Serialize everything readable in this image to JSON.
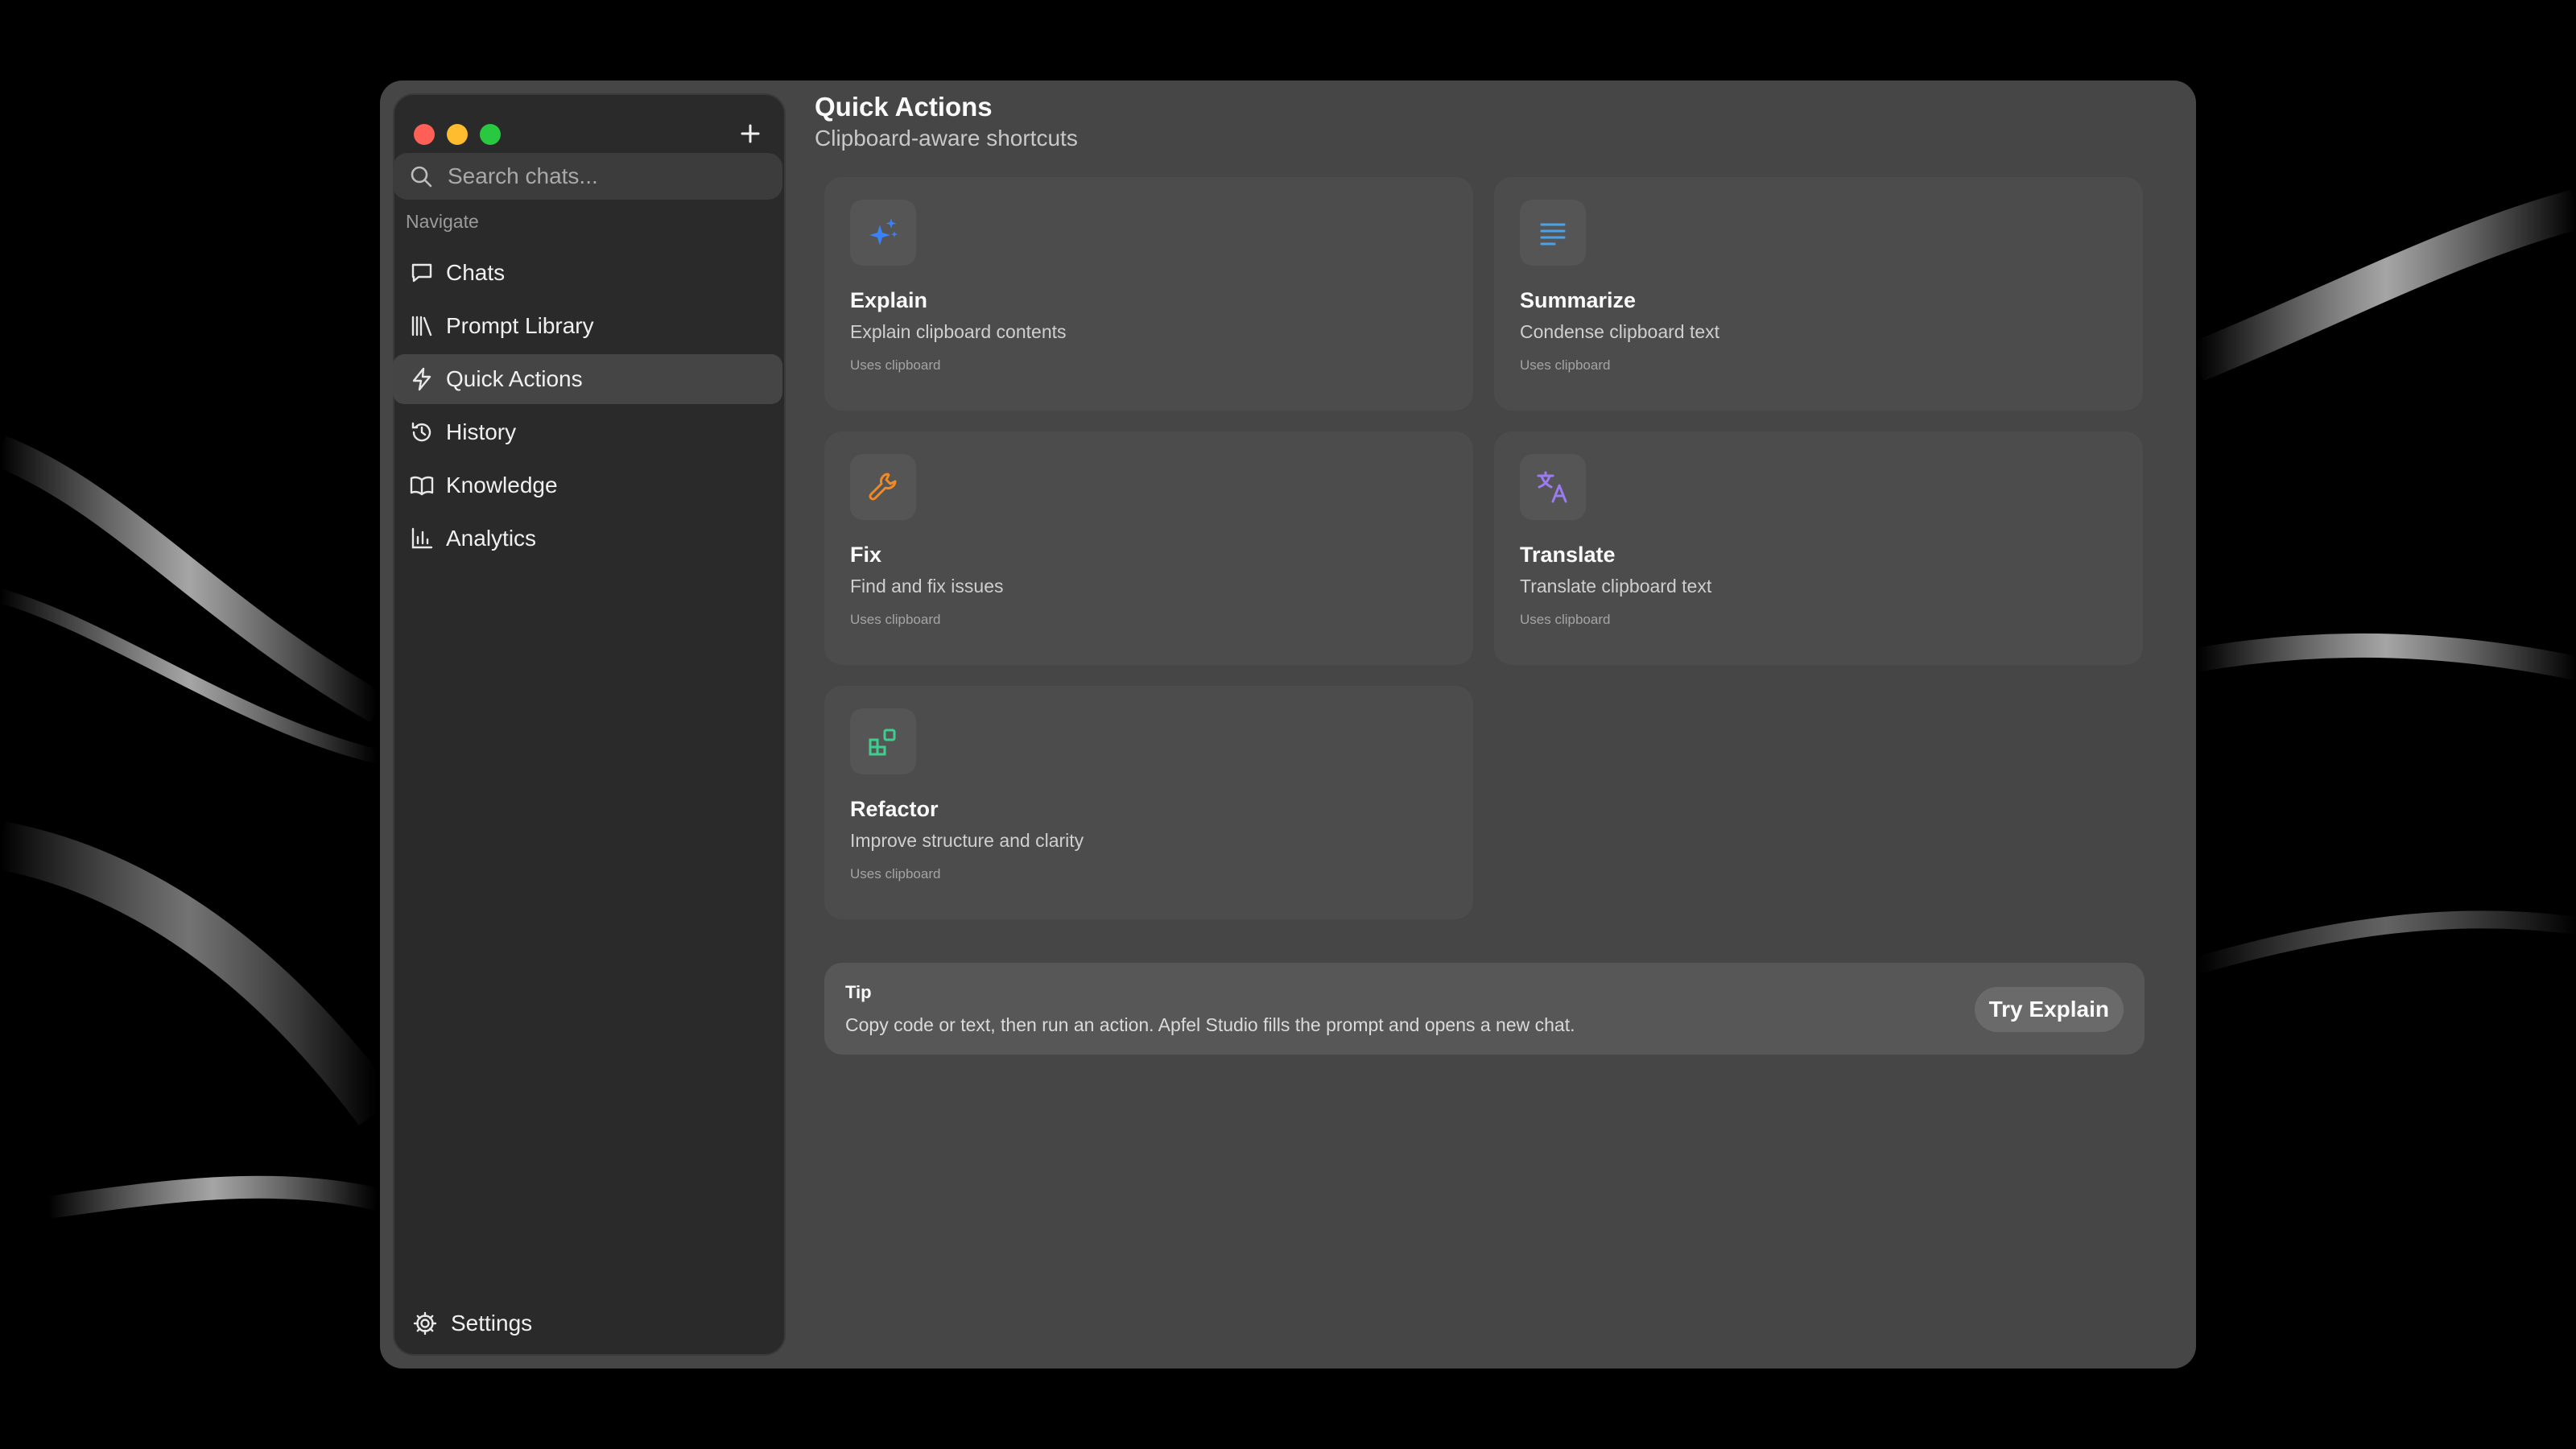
{
  "sidebar": {
    "search_placeholder": "Search chats...",
    "section_label": "Navigate",
    "items": [
      {
        "label": "Chats",
        "icon": "chat-bubble-icon"
      },
      {
        "label": "Prompt Library",
        "icon": "library-icon"
      },
      {
        "label": "Quick Actions",
        "icon": "lightning-icon",
        "active": true
      },
      {
        "label": "History",
        "icon": "history-icon"
      },
      {
        "label": "Knowledge",
        "icon": "book-icon"
      },
      {
        "label": "Analytics",
        "icon": "bar-chart-icon"
      }
    ],
    "settings_label": "Settings"
  },
  "main": {
    "title": "Quick Actions",
    "subtitle": "Clipboard-aware shortcuts",
    "cards": [
      {
        "title": "Explain",
        "description": "Explain clipboard contents",
        "footer": "Uses clipboard",
        "icon": "sparkles-icon",
        "accent": "#3b82f6"
      },
      {
        "title": "Summarize",
        "description": "Condense clipboard text",
        "footer": "Uses clipboard",
        "icon": "text-lines-icon",
        "accent": "#4aa3e8"
      },
      {
        "title": "Fix",
        "description": "Find and fix issues",
        "footer": "Uses clipboard",
        "icon": "wrench-icon",
        "accent": "#f08a24"
      },
      {
        "title": "Translate",
        "description": "Translate clipboard text",
        "footer": "Uses clipboard",
        "icon": "translate-icon",
        "accent": "#9b7bf0"
      },
      {
        "title": "Refactor",
        "description": "Improve structure and clarity",
        "footer": "Uses clipboard",
        "icon": "blocks-icon",
        "accent": "#3ecf8e"
      }
    ],
    "tip": {
      "title": "Tip",
      "body": "Copy code or text, then run an action. Apfel Studio fills the prompt and opens a new chat.",
      "button_label": "Try Explain"
    }
  },
  "colors": {
    "window_bg": "#464646",
    "sidebar_bg": "#2a2a2a",
    "card_bg": "#4c4c4c",
    "traffic_red": "#fe5f57",
    "traffic_yellow": "#febc2e",
    "traffic_green": "#28c840"
  }
}
